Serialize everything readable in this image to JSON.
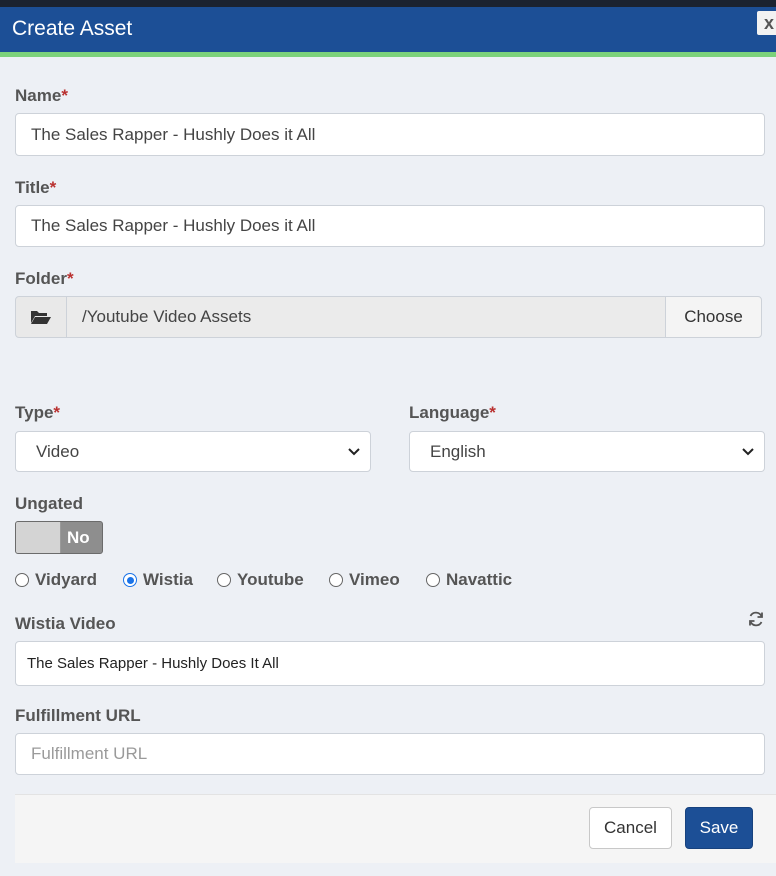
{
  "dialog": {
    "title": "Create Asset",
    "close_label": "x"
  },
  "fields": {
    "name": {
      "label": "Name",
      "required": "*",
      "value": "The Sales Rapper - Hushly Does it All"
    },
    "title": {
      "label": "Title",
      "required": "*",
      "value": "The Sales Rapper - Hushly Does it All"
    },
    "folder": {
      "label": "Folder",
      "required": "*",
      "value": "/Youtube Video Assets",
      "choose_label": "Choose",
      "icon": "folder-open-icon"
    },
    "type": {
      "label": "Type",
      "required": "*",
      "value": "Video"
    },
    "language": {
      "label": "Language",
      "required": "*",
      "value": "English"
    },
    "ungated": {
      "label": "Ungated",
      "toggle_text": "No"
    },
    "providers": [
      {
        "label": "Vidyard",
        "checked": false
      },
      {
        "label": "Wistia",
        "checked": true
      },
      {
        "label": "Youtube",
        "checked": false
      },
      {
        "label": "Vimeo",
        "checked": false
      },
      {
        "label": "Navattic",
        "checked": false
      }
    ],
    "wistia_video": {
      "label": "Wistia Video",
      "value": "The Sales Rapper - Hushly Does It All",
      "icon": "refresh-icon"
    },
    "fulfillment_url": {
      "label": "Fulfillment URL",
      "placeholder": "Fulfillment URL"
    }
  },
  "footer": {
    "cancel_label": "Cancel",
    "save_label": "Save"
  },
  "colors": {
    "header": "#1c4f96",
    "accent_bar": "#7cd27b",
    "required": "#b9302f",
    "radio_checked": "#1a73e8"
  }
}
